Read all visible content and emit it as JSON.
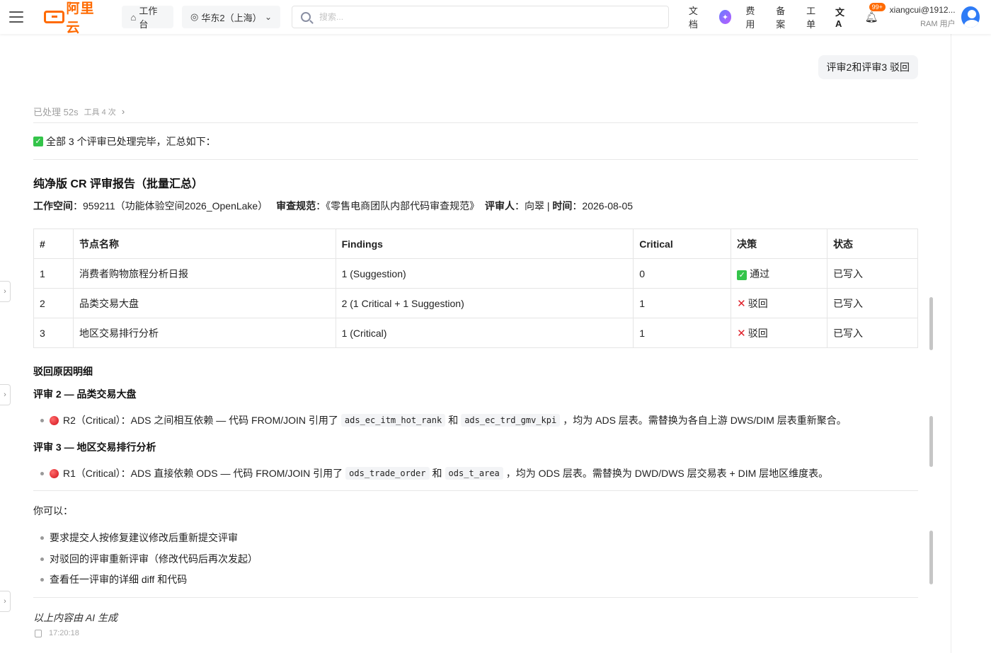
{
  "topbar": {
    "logo_text": "阿里云",
    "workbench": "工作台",
    "region": "华东2（上海）",
    "search_placeholder": "搜索...",
    "links": [
      "文档",
      "费用",
      "备案",
      "工单"
    ],
    "bell_badge": "99+",
    "user_name": "xiangcui@1912...",
    "user_role": "RAM 用户"
  },
  "chat": {
    "user_message": "评审2和评审3 驳回",
    "processed": "已处理 52s",
    "tools": "工具 4 次",
    "summary": "全部 3 个评审已处理完毕，汇总如下：",
    "report_title": "纯净版 CR 评审报告（批量汇总）",
    "meta": {
      "workspace_label": "工作空间",
      "workspace_value": "：959211（功能体验空间2026_OpenLake）",
      "standard_label": "审查规范",
      "standard_value": "：《零售电商团队内部代码审查规范》",
      "reviewer_label": "评审人",
      "reviewer_value": "：向翠 | ",
      "time_label": "时间",
      "time_value": "：2026-08-05"
    },
    "table": {
      "headers": [
        "#",
        "节点名称",
        "Findings",
        "Critical",
        "决策",
        "状态"
      ],
      "rows": [
        {
          "num": "1",
          "name": "消费者购物旅程分析日报",
          "findings": "1 (Suggestion)",
          "critical": "0",
          "decision": "通过",
          "decision_type": "pass",
          "status": "已写入"
        },
        {
          "num": "2",
          "name": "品类交易大盘",
          "findings": "2 (1 Critical + 1 Suggestion)",
          "critical": "1",
          "decision": "驳回",
          "decision_type": "reject",
          "status": "已写入"
        },
        {
          "num": "3",
          "name": "地区交易排行分析",
          "findings": "1 (Critical)",
          "critical": "1",
          "decision": "驳回",
          "decision_type": "reject",
          "status": "已写入"
        }
      ]
    },
    "reject_title": "驳回原因明细",
    "review2": {
      "title": "评审 2 — 品类交易大盘",
      "prefix": "R2（Critical）：ADS 之间相互依赖 — 代码 FROM/JOIN 引用了",
      "code1": "ads_ec_itm_hot_rank",
      "mid": "和",
      "code2": "ads_ec_trd_gmv_kpi",
      "suffix": "，均为 ADS 层表。需替换为各自上游 DWS/DIM 层表重新聚合。"
    },
    "review3": {
      "title": "评审 3 — 地区交易排行分析",
      "prefix": "R1（Critical）：ADS 直接依赖 ODS — 代码 FROM/JOIN 引用了",
      "code1": "ods_trade_order",
      "mid": "和",
      "code2": "ods_t_area",
      "suffix": "，均为 ODS 层表。需替换为 DWD/DWS 层交易表 + DIM 层地区维度表。"
    },
    "you_can": "你可以：",
    "options": [
      "要求提交人按修复建议修改后重新提交评审",
      "对驳回的评审重新评审（修改代码后再次发起）",
      "查看任一评审的详细 diff 和代码"
    ],
    "ai_generated": "以上内容由 AI 生成",
    "timestamp": "17:20:18"
  },
  "colors": {
    "brand": "#ff6a00",
    "pass": "#34c44a",
    "reject": "#e0202a"
  }
}
